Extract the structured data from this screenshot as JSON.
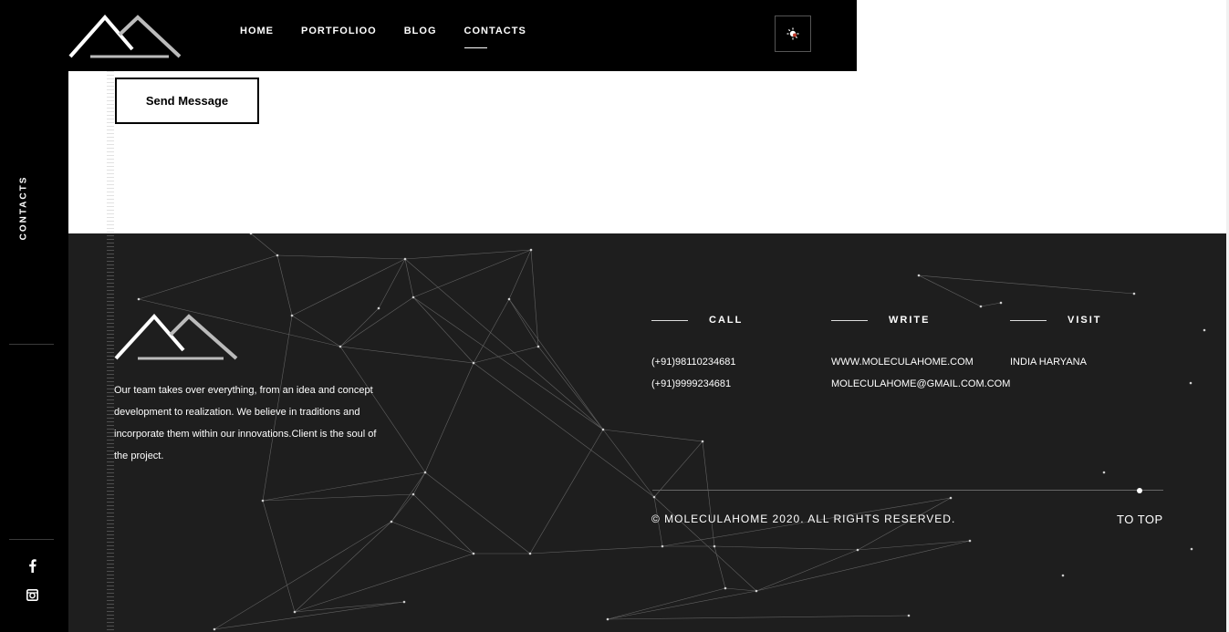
{
  "nav": {
    "items": [
      {
        "label": "HOME",
        "active": false
      },
      {
        "label": "PORTFOLIOO",
        "active": false
      },
      {
        "label": "BLOG",
        "active": false
      },
      {
        "label": "CONTACTS",
        "active": true
      }
    ],
    "theme_icon": "sun-moon-icon"
  },
  "sidebar": {
    "section_label": "CONTACTS",
    "social": [
      "facebook-icon",
      "instagram-icon"
    ]
  },
  "form": {
    "submit_label": "Send Message"
  },
  "footer": {
    "about": "Our team takes over everything, from an idea and concept development to realization. We believe in traditions and incorporate them within our innovations.Client is the soul of the project.",
    "columns": [
      {
        "title": "CALL",
        "lines": [
          "(+91)98110234681",
          "(+91)9999234681"
        ]
      },
      {
        "title": "WRITE",
        "lines": [
          "WWW.MOLECULAHOME.COM",
          "MOLECULAHOME@GMAIL.COM.COM"
        ]
      },
      {
        "title": "VISIT",
        "lines": [
          "INDIA HARYANA"
        ]
      }
    ],
    "copyright": "© MOLECULAHOME 2020. ALL RIGHTS RESERVED.",
    "to_top": "TO TOP"
  },
  "colors": {
    "dark": "#000000",
    "footer": "#1e1e1e",
    "text_light": "#ffffff",
    "logo_gray": "#bbbbbb"
  }
}
